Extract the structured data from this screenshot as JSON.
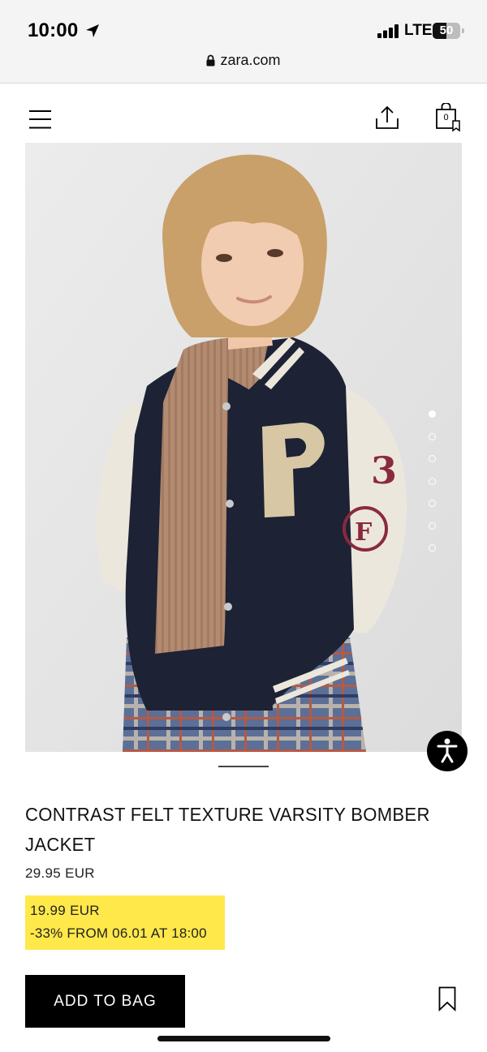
{
  "status_bar": {
    "time": "10:00",
    "network": "LTE",
    "battery_level": "50",
    "battery_fraction": 0.5,
    "icons": [
      "location-arrow-icon",
      "signal-icon",
      "battery-icon"
    ]
  },
  "browser": {
    "url": "zara.com"
  },
  "header": {
    "bag_count": "0",
    "icons": [
      "menu-icon",
      "share-icon",
      "bag-icon"
    ]
  },
  "gallery": {
    "image_count": 7,
    "active_index": 0
  },
  "product": {
    "title": "CONTRAST FELT TEXTURE VARSITY BOMBER JACKET",
    "original_price": "29.95 EUR",
    "promo_price": "19.99 EUR",
    "promo_detail": "-33% FROM 06.01 AT 18:00",
    "promo_color": "#ffe84a"
  },
  "actions": {
    "add_to_bag_label": "ADD TO BAG"
  }
}
